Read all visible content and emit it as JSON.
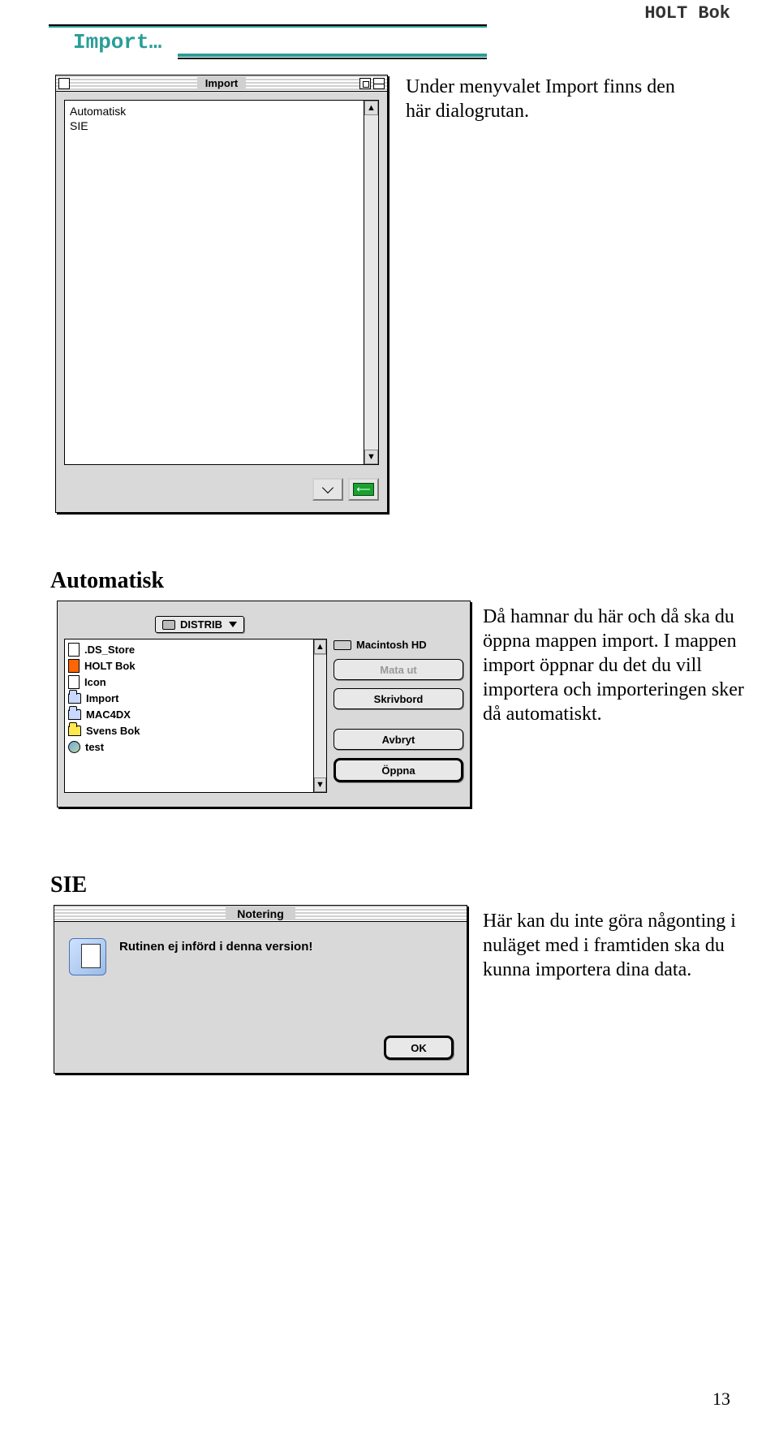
{
  "header": {
    "doc_name": "HOLT Bok"
  },
  "section": {
    "title": "Import…"
  },
  "import_window": {
    "title": "Import",
    "items": [
      "Automatisk",
      "SIE"
    ]
  },
  "intro_para": "Under menyvalet Import finns den här dialogrutan.",
  "headings": {
    "auto": "Automatisk",
    "sie": "SIE"
  },
  "open_dialog": {
    "popup_label": "DISTRIB",
    "volume_label": "Macintosh HD",
    "buttons": {
      "eject": "Mata ut",
      "desktop": "Skrivbord",
      "cancel": "Avbryt",
      "open": "Öppna"
    },
    "files": [
      {
        "name": ".DS_Store",
        "type": "file"
      },
      {
        "name": "HOLT Bok",
        "type": "file-sel"
      },
      {
        "name": "Icon",
        "type": "file"
      },
      {
        "name": "Import",
        "type": "folder"
      },
      {
        "name": "MAC4DX",
        "type": "folder"
      },
      {
        "name": "Svens Bok",
        "type": "folder-yellow"
      },
      {
        "name": "test",
        "type": "globe"
      }
    ]
  },
  "auto_para": "Då hamnar du här och då ska du öppna mappen import. I mappen import öppnar du det du vill importera och importeringen sker då automatiskt.",
  "note_dialog": {
    "title": "Notering",
    "text": "Rutinen ej införd i denna version!",
    "ok": "OK"
  },
  "sie_para": "Här kan du inte göra någonting i nuläget med i framtiden ska du kunna importera dina data.",
  "page_number": "13"
}
